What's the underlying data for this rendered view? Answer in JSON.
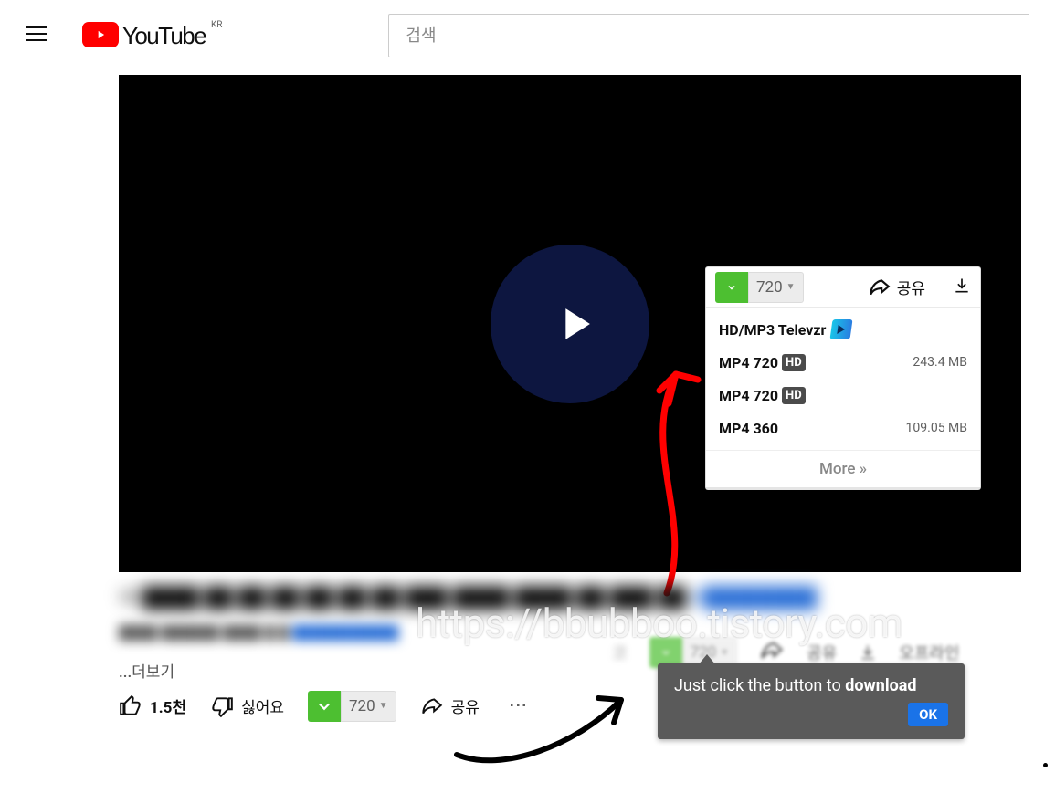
{
  "header": {
    "brand_text": "YouTube",
    "region": "KR",
    "search_placeholder": "검색"
  },
  "download_popup": {
    "selected_resolution": "720",
    "share_label": "공유",
    "rows": [
      {
        "label": "HD/MP3 Televzr",
        "hd": false,
        "televzr": true,
        "size": ""
      },
      {
        "label": "MP4 720",
        "hd": true,
        "size": "243.4 MB"
      },
      {
        "label": "MP4 720",
        "hd": true,
        "size": ""
      },
      {
        "label": "MP4 360",
        "hd": false,
        "size": "109.05 MB"
      }
    ],
    "more_label": "More »"
  },
  "tooltip": {
    "text_prefix": "Just click the button to ",
    "text_bold": "download",
    "ok_label": "OK"
  },
  "under_video": {
    "blurred_title_filler": "내 ████ ██ ██ ██  ██ ██  ██ ███ ████ ████ ██  ███  ██",
    "blurred_title_blue": "#████████",
    "blurred_meta_filler": "████ ██████ ████-█-█ ",
    "blurred_meta_blue": "███████████",
    "more_link": "...더보기",
    "action_bg_ko": "코",
    "action_bg_resolution": "720",
    "action_bg_share": "공유",
    "action_bg_offline": "오프라인"
  },
  "watermark": "https://bbubboo.tistory.com",
  "bottom_actions": {
    "likes": "1.5천",
    "dislike_label": "싫어요",
    "download_resolution": "720",
    "share_label": "공유",
    "more_glyph": "⋮"
  }
}
